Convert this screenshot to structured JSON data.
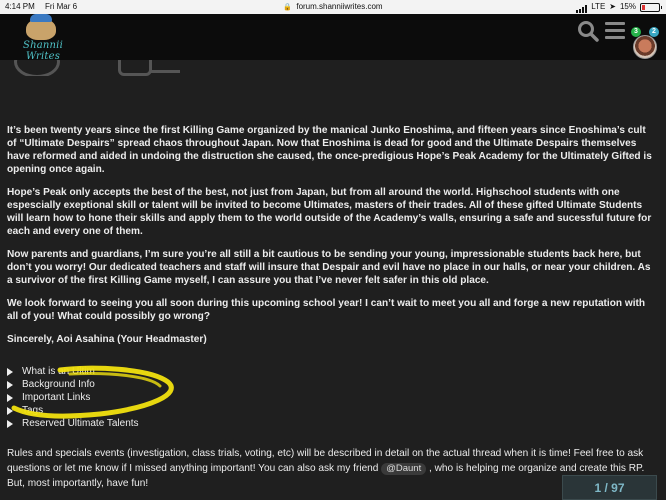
{
  "statusbar": {
    "time": "4:14 PM",
    "date": "Fri Mar 6",
    "url": "forum.shanniiwrites.com",
    "network": "LTE",
    "battery": "15%"
  },
  "header": {
    "logo_text": "Shannii Writes",
    "search_icon": "search-icon",
    "menu_icon": "hamburger-menu-icon",
    "notifications_count": "3",
    "messages_count": "2"
  },
  "post": {
    "paragraphs": [
      "It’s been twenty years since the first Killing Game organized by the manical Junko Enoshima, and fifteen years since Enoshima’s cult of “Ultimate Despairs” spread chaos throughout Japan. Now that Enoshima is dead for good and the Ultimate Despairs themselves have reformed and aided in undoing the distruction she caused, the once-predigious Hope’s Peak Academy for the Ultimately Gifted is opening once again.",
      "Hope’s Peak only accepts the best of the best, not just from Japan, but from all around the world. Highschool students with one espescially exeptional skill or talent will be invited to become Ultimates, masters of their trades. All of these gifted Ultimate Students will learn how to hone their skills and apply them to the world outside of the Academy’s walls, ensuring a safe and sucessful future for each and every one of them.",
      "Now parents and guardians, I’m sure you’re all still a bit cautious to be sending your young, impressionable students back here, but don’t you worry! Our dedicated teachers and staff will insure that Despair and evil have no place in our halls, or near your children. As a survivor of the first Killing Game myself, I can assure you that I’ve never felt safer in this old place.",
      "We look forward to seeing you all soon during this upcoming school year! I can’t wait to meet you all and forge a new reputation with all of you! What could possibly go wrong?"
    ],
    "signature": "Sincerely, Aoi Asahina (Your Headmaster)"
  },
  "details": [
    {
      "label": "What is an Ultim"
    },
    {
      "label": "Background Info"
    },
    {
      "label": "Important Links"
    },
    {
      "label": "Tags"
    },
    {
      "label": "Reserved Ultimate Talents"
    }
  ],
  "rules": {
    "before": "Rules and specials events (investigation, class trials, voting, etc) will be described in detail on the actual thread when it is time! Feel free to ask questions or let me know if I missed anything important! You can also ask my friend ",
    "mention": "@Daunt",
    "after": " , who is helping me organize and create this RP. But, most importantly, have fun!"
  },
  "progress": {
    "current": "1",
    "separator": " / ",
    "total": "97"
  },
  "colors": {
    "background": "#1f1f1f",
    "header": "#0c0c0c",
    "logo_accent": "#4fc2c7",
    "highlight_marker": "#f2e20f",
    "progress_text": "#7fb8c7"
  }
}
